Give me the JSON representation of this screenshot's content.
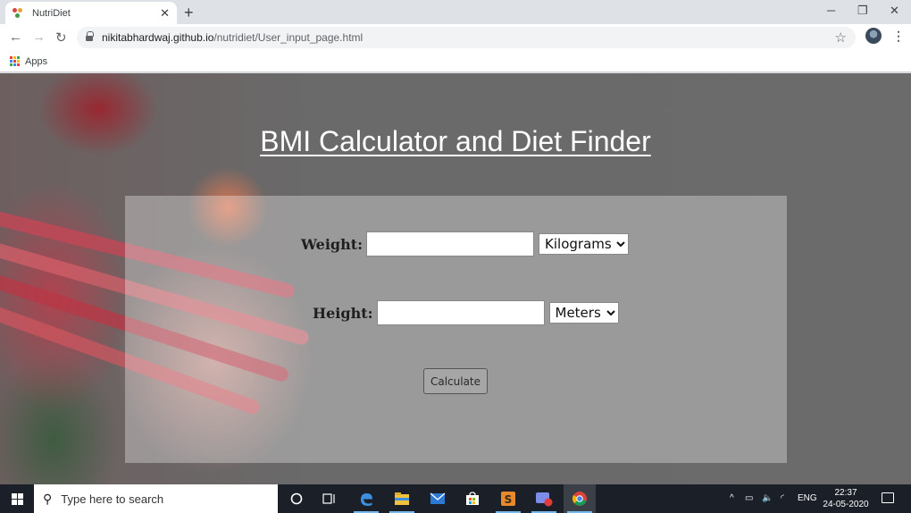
{
  "browser": {
    "tab_title": "NutriDiet",
    "url_host": "nikitabhardwaj.github.io",
    "url_path": "/nutridiet/User_input_page.html",
    "bookmarks": [
      {
        "label": "Apps"
      }
    ]
  },
  "page": {
    "title": "BMI Calculator and Diet Finder",
    "weight": {
      "label": "Weight:",
      "value": "",
      "unit_selected": "Kilograms"
    },
    "height": {
      "label": "Height:",
      "value": "",
      "unit_selected": "Meters"
    },
    "calculate_label": "Calculate"
  },
  "taskbar": {
    "search_placeholder": "Type here to search",
    "language": "ENG",
    "time": "22:37",
    "date": "24-05-2020"
  },
  "colors": {
    "title_text": "#ffffff",
    "taskbar_bg": "#1b1f27",
    "chrome_bg": "#dee1e6",
    "active_indicator": "#76b9ed"
  },
  "icons": {
    "tab_favicon": "nutridiet-logo-icon",
    "lock": "lock-icon",
    "bookmark_star": "star-icon",
    "start": "windows-start-icon",
    "taskbar_apps": [
      "cortana-icon",
      "task-view-icon",
      "edge-icon",
      "file-explorer-icon",
      "mail-icon",
      "store-icon",
      "sublime-text-icon",
      "screen-recorder-icon",
      "chrome-icon"
    ]
  }
}
